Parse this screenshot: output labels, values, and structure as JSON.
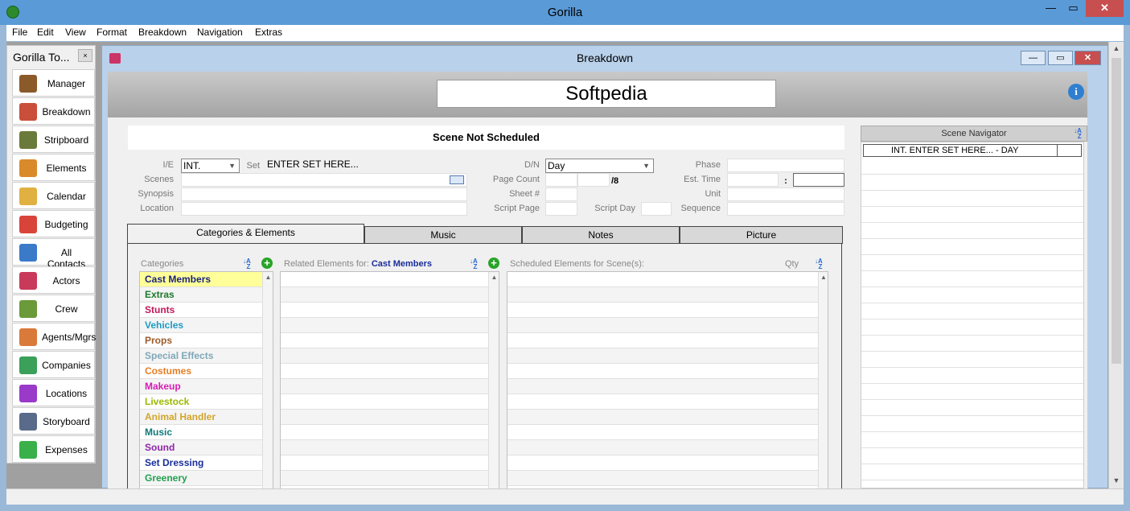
{
  "app": {
    "title": "Gorilla"
  },
  "window_controls": {
    "minimize": "—",
    "maximize": "▭",
    "close": "✕"
  },
  "menu": [
    "File",
    "Edit",
    "View",
    "Format",
    "Breakdown",
    "Navigation",
    "Extras"
  ],
  "toolbox": {
    "title": "Gorilla To...",
    "close": "×",
    "items": [
      {
        "label": "Manager",
        "icon": "briefcase-icon",
        "color": "#8b5a2b"
      },
      {
        "label": "Breakdown",
        "icon": "breakdown-grid-icon",
        "color": "#c94f3a"
      },
      {
        "label": "Stripboard",
        "icon": "stripboard-icon",
        "color": "#6a7a3a"
      },
      {
        "label": "Elements",
        "icon": "gun-icon",
        "color": "#d98a2b"
      },
      {
        "label": "Calendar",
        "icon": "calendar-icon",
        "color": "#e0b040"
      },
      {
        "label": "Budgeting",
        "icon": "budget-chart-icon",
        "color": "#d9443a"
      },
      {
        "label": "All Contacts",
        "icon": "contacts-icon",
        "color": "#3a7ac9"
      },
      {
        "label": "Actors",
        "icon": "actor-icon",
        "color": "#c93a5a"
      },
      {
        "label": "Crew",
        "icon": "crew-tools-icon",
        "color": "#6a9a3a"
      },
      {
        "label": "Agents/Mgrs",
        "icon": "agent-icon",
        "color": "#d97a3a"
      },
      {
        "label": "Companies",
        "icon": "companies-icon",
        "color": "#3aa05a"
      },
      {
        "label": "Locations",
        "icon": "location-compass-icon",
        "color": "#9a3ac9"
      },
      {
        "label": "Storyboard",
        "icon": "storyboard-icon",
        "color": "#5a6a8a"
      },
      {
        "label": "Expenses",
        "icon": "expenses-chart-icon",
        "color": "#3ab04a"
      }
    ]
  },
  "breakdown": {
    "window_title": "Breakdown",
    "project_title": "Softpedia",
    "scene_status": "Scene Not Scheduled",
    "labels": {
      "ie": "I/E",
      "set": "Set",
      "scenes": "Scenes",
      "synopsis": "Synopsis",
      "location": "Location",
      "dn": "D/N",
      "page_count": "Page Count",
      "sheet": "Sheet #",
      "script_page": "Script Page",
      "script_day": "Script Day",
      "phase": "Phase",
      "est_time": "Est. Time",
      "unit": "Unit",
      "sequence": "Sequence"
    },
    "values": {
      "ie": "INT.",
      "set": "ENTER SET HERE...",
      "dn": "Day",
      "page_denominator": "/8",
      "time_sep": ":"
    },
    "tabs": [
      "Categories & Elements",
      "Music",
      "Notes",
      "Picture"
    ],
    "columns": {
      "categories": "Categories",
      "related_prefix": "Related Elements for:",
      "related_category": "Cast Members",
      "scheduled": "Scheduled Elements for Scene(s):",
      "qty": "Qty"
    },
    "categories": [
      {
        "label": "Cast Members",
        "color": "#1a237e"
      },
      {
        "label": "Extras",
        "color": "#1b7a2a"
      },
      {
        "label": "Stunts",
        "color": "#c2185b"
      },
      {
        "label": "Vehicles",
        "color": "#1e9bc4"
      },
      {
        "label": "Props",
        "color": "#9c5a2a"
      },
      {
        "label": "Special Effects",
        "color": "#7fa8b8"
      },
      {
        "label": "Costumes",
        "color": "#e67e22"
      },
      {
        "label": "Makeup",
        "color": "#d81bb5"
      },
      {
        "label": "Livestock",
        "color": "#9ab800"
      },
      {
        "label": "Animal Handler",
        "color": "#d4a52a"
      },
      {
        "label": "Music",
        "color": "#0e7a7a"
      },
      {
        "label": "Sound",
        "color": "#8e24aa"
      },
      {
        "label": "Set Dressing",
        "color": "#1a2e9a"
      },
      {
        "label": "Greenery",
        "color": "#20a050"
      }
    ],
    "sort_icon": "sort-az-icon",
    "add_icon": "+"
  },
  "scene_navigator": {
    "title": "Scene Navigator",
    "first_row": "INT. ENTER SET HERE... - DAY"
  },
  "info_icon": "i"
}
